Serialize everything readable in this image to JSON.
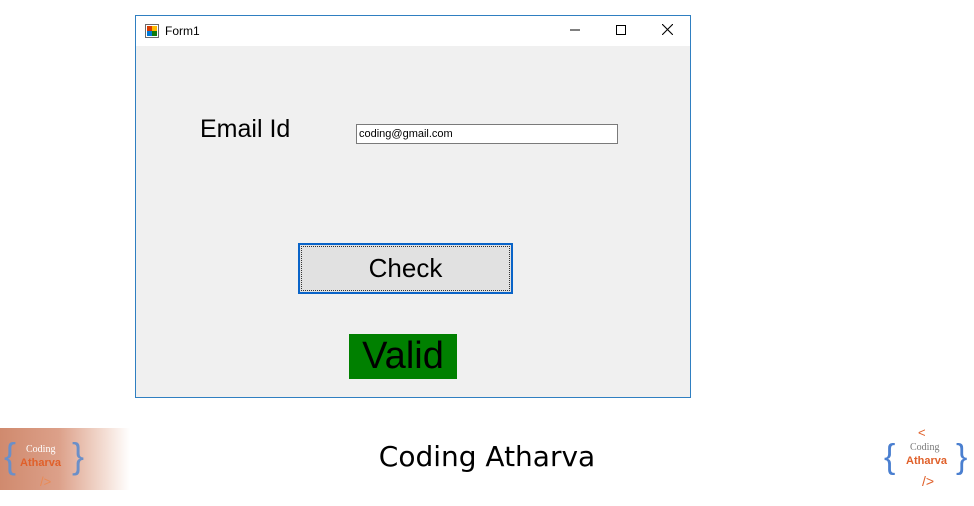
{
  "window": {
    "title": "Form1",
    "controls": {
      "minimize": "minimize",
      "maximize": "maximize",
      "close": "close"
    }
  },
  "form": {
    "email_label": "Email Id",
    "email_value": "coding@gmail.com",
    "check_button": "Check",
    "result_text": "Valid",
    "result_background": "#008000"
  },
  "footer": {
    "caption": "Coding Atharva",
    "logo": {
      "open_tag": "<",
      "close_tag": "/>",
      "line1": "Coding",
      "line2": "Atharva",
      "brace_color": "#4a7fd0",
      "accent_color": "#e0602a"
    }
  }
}
